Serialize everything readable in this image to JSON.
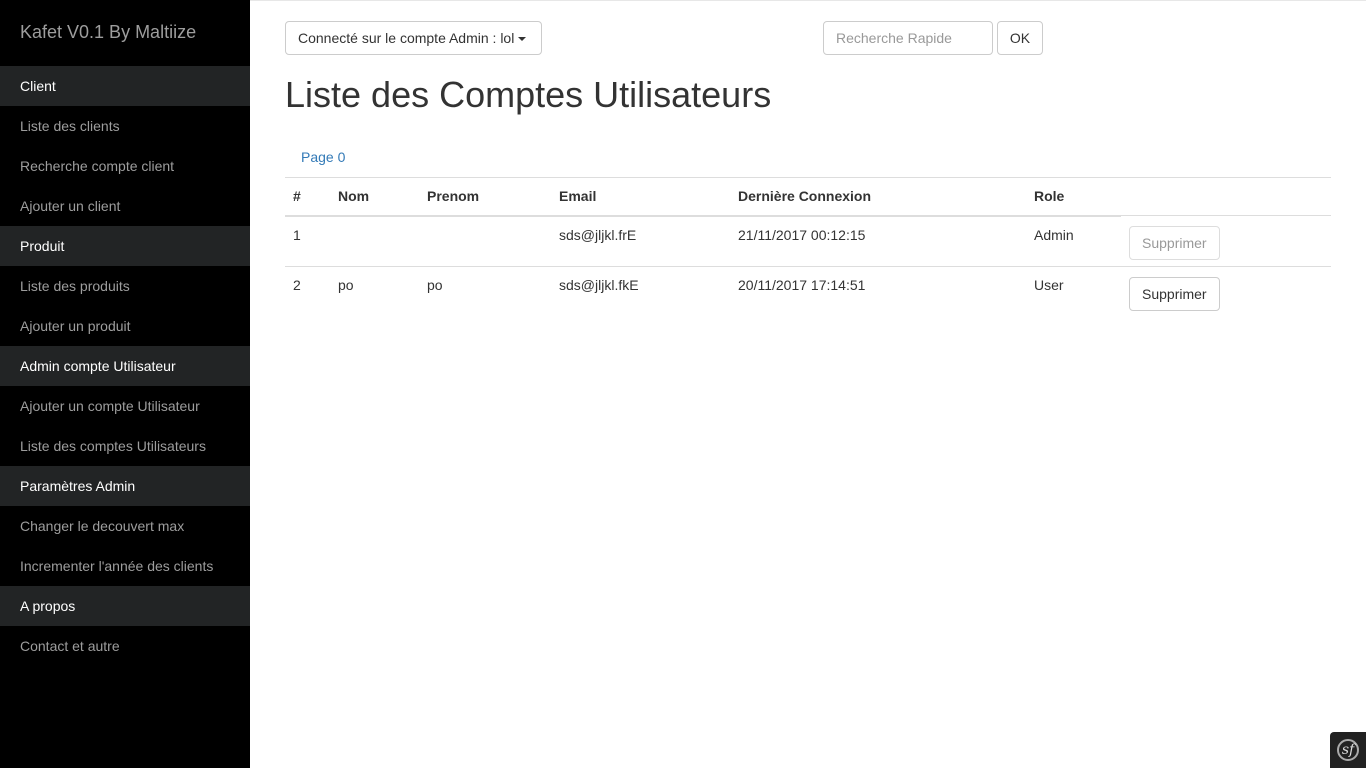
{
  "app": {
    "title": "Kafet V0.1 By Maltiize"
  },
  "sidebar": {
    "items": [
      {
        "label": "Client",
        "type": "header"
      },
      {
        "label": "Liste des clients",
        "type": "link"
      },
      {
        "label": "Recherche compte client",
        "type": "link"
      },
      {
        "label": "Ajouter un client",
        "type": "link"
      },
      {
        "label": "Produit",
        "type": "header"
      },
      {
        "label": "Liste des produits",
        "type": "link"
      },
      {
        "label": "Ajouter un produit",
        "type": "link"
      },
      {
        "label": "Admin compte Utilisateur",
        "type": "header"
      },
      {
        "label": "Ajouter un compte Utilisateur",
        "type": "link"
      },
      {
        "label": "Liste des comptes Utilisateurs",
        "type": "link"
      },
      {
        "label": "Paramètres Admin",
        "type": "header"
      },
      {
        "label": "Changer le decouvert max",
        "type": "link"
      },
      {
        "label": "Incrementer l'année des clients",
        "type": "link"
      },
      {
        "label": "A propos",
        "type": "header"
      },
      {
        "label": "Contact et autre",
        "type": "link"
      }
    ]
  },
  "header": {
    "account_label": "Connecté sur le compte Admin : lol",
    "search_placeholder": "Recherche Rapide",
    "search_button": "OK"
  },
  "main": {
    "title": "Liste des Comptes Utilisateurs",
    "pager": "Page 0",
    "table": {
      "columns": [
        "#",
        "Nom",
        "Prenom",
        "Email",
        "Dernière Connexion",
        "Role",
        ""
      ],
      "rows": [
        {
          "id": "1",
          "nom": "",
          "prenom": "",
          "email": "sds@jljkl.frE",
          "last_login": "21/11/2017 00:12:15",
          "role": "Admin",
          "action": "Supprimer",
          "action_disabled": true
        },
        {
          "id": "2",
          "nom": "po",
          "prenom": "po",
          "email": "sds@jljkl.fkE",
          "last_login": "20/11/2017 17:14:51",
          "role": "User",
          "action": "Supprimer",
          "action_disabled": false
        }
      ]
    }
  },
  "colors": {
    "sidebar_bg": "#000000",
    "sidebar_header_bg": "#222425",
    "link": "#337ab7"
  },
  "icons": {
    "debug_toolbar": "symfony-icon"
  }
}
